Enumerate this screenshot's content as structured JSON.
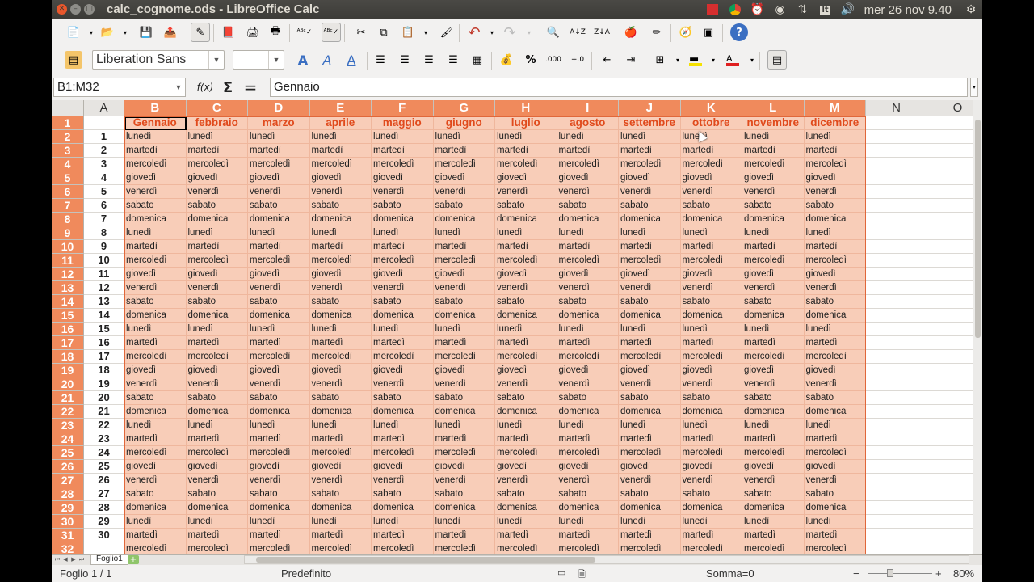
{
  "window": {
    "title": "calc_cognome.ods - LibreOffice Calc"
  },
  "tray": {
    "clock": "mer 26 nov  9.40",
    "lt": "lt"
  },
  "toolbar": {
    "font_name": "Liberation Sans",
    "font_size": "",
    "percent": "%",
    "decimal": ".000"
  },
  "formula_bar": {
    "name_box": "B1:M32",
    "fx": "f(x)",
    "sum": "Σ",
    "equals": "=",
    "content": "Gennaio"
  },
  "columns": [
    "A",
    "B",
    "C",
    "D",
    "E",
    "F",
    "G",
    "H",
    "I",
    "J",
    "K",
    "L",
    "M",
    "N",
    "O"
  ],
  "selected_columns": [
    "B",
    "C",
    "D",
    "E",
    "F",
    "G",
    "H",
    "I",
    "J",
    "K",
    "L",
    "M"
  ],
  "rows": [
    "1",
    "2",
    "3",
    "4",
    "5",
    "6",
    "7",
    "8",
    "9",
    "10",
    "11",
    "12",
    "13",
    "14",
    "15",
    "16",
    "17",
    "18",
    "19",
    "20",
    "21",
    "22",
    "23",
    "24",
    "25",
    "26",
    "27",
    "28",
    "29",
    "30",
    "31",
    "32"
  ],
  "months": [
    "Gennaio",
    "febbraio",
    "marzo",
    "aprile",
    "maggio",
    "giugno",
    "luglio",
    "agosto",
    "settembre",
    "ottobre",
    "novembre",
    "dicembre"
  ],
  "day_numbers": [
    "1",
    "2",
    "3",
    "4",
    "5",
    "6",
    "7",
    "8",
    "9",
    "10",
    "11",
    "12",
    "13",
    "14",
    "15",
    "16",
    "17",
    "18",
    "19",
    "20",
    "21",
    "22",
    "23",
    "24",
    "25",
    "26",
    "27",
    "28",
    "29",
    "30"
  ],
  "weekday_cycle": [
    "lunedì",
    "martedì",
    "mercoledì",
    "giovedì",
    "venerdì",
    "sabato",
    "domenica"
  ],
  "sheet": {
    "tab": "Foglio1",
    "add": "+"
  },
  "status": {
    "sheet": "Foglio 1 / 1",
    "style": "Predefinito",
    "sum": "Somma=0",
    "zoom": "80%"
  },
  "colors": {
    "selection": "#f8cdb8",
    "header_selected": "#f08a5c",
    "month_text": "#e04a1c"
  }
}
